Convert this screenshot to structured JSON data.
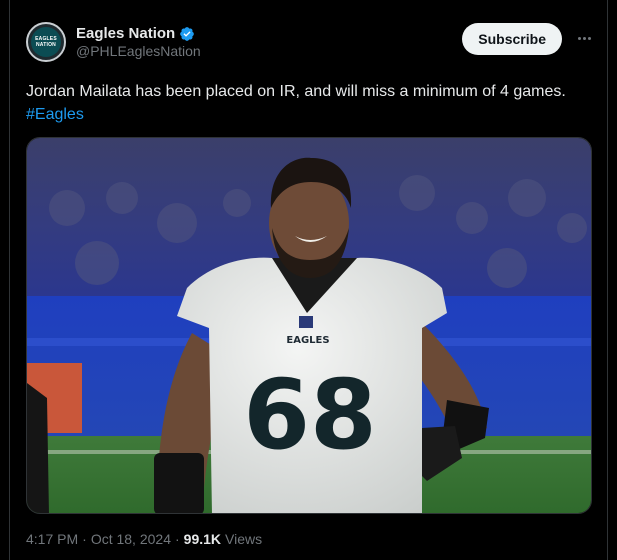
{
  "account": {
    "display_name": "Eagles Nation",
    "handle": "@PHLEaglesNation",
    "avatar_text_line1": "EAGLES",
    "avatar_text_line2": "NATION"
  },
  "actions": {
    "subscribe_label": "Subscribe",
    "more_icon": "more-horizontal-icon"
  },
  "tweet": {
    "text": "Jordan Mailata has been placed on IR, and will miss a minimum of 4 games.",
    "hashtag": "#Eagles",
    "time": "4:17 PM",
    "separator": "·",
    "date": "Oct 18, 2024",
    "views_count": "99.1K",
    "views_label": "Views"
  },
  "photo": {
    "jersey_number": "68",
    "jersey_wordmark": "EAGLES"
  },
  "colors": {
    "background": "#000000",
    "text": "#e7e9ea",
    "muted": "#71767b",
    "link": "#1d9bf0",
    "verified": "#1d9bf0",
    "subscribe_bg": "#eff3f4"
  }
}
